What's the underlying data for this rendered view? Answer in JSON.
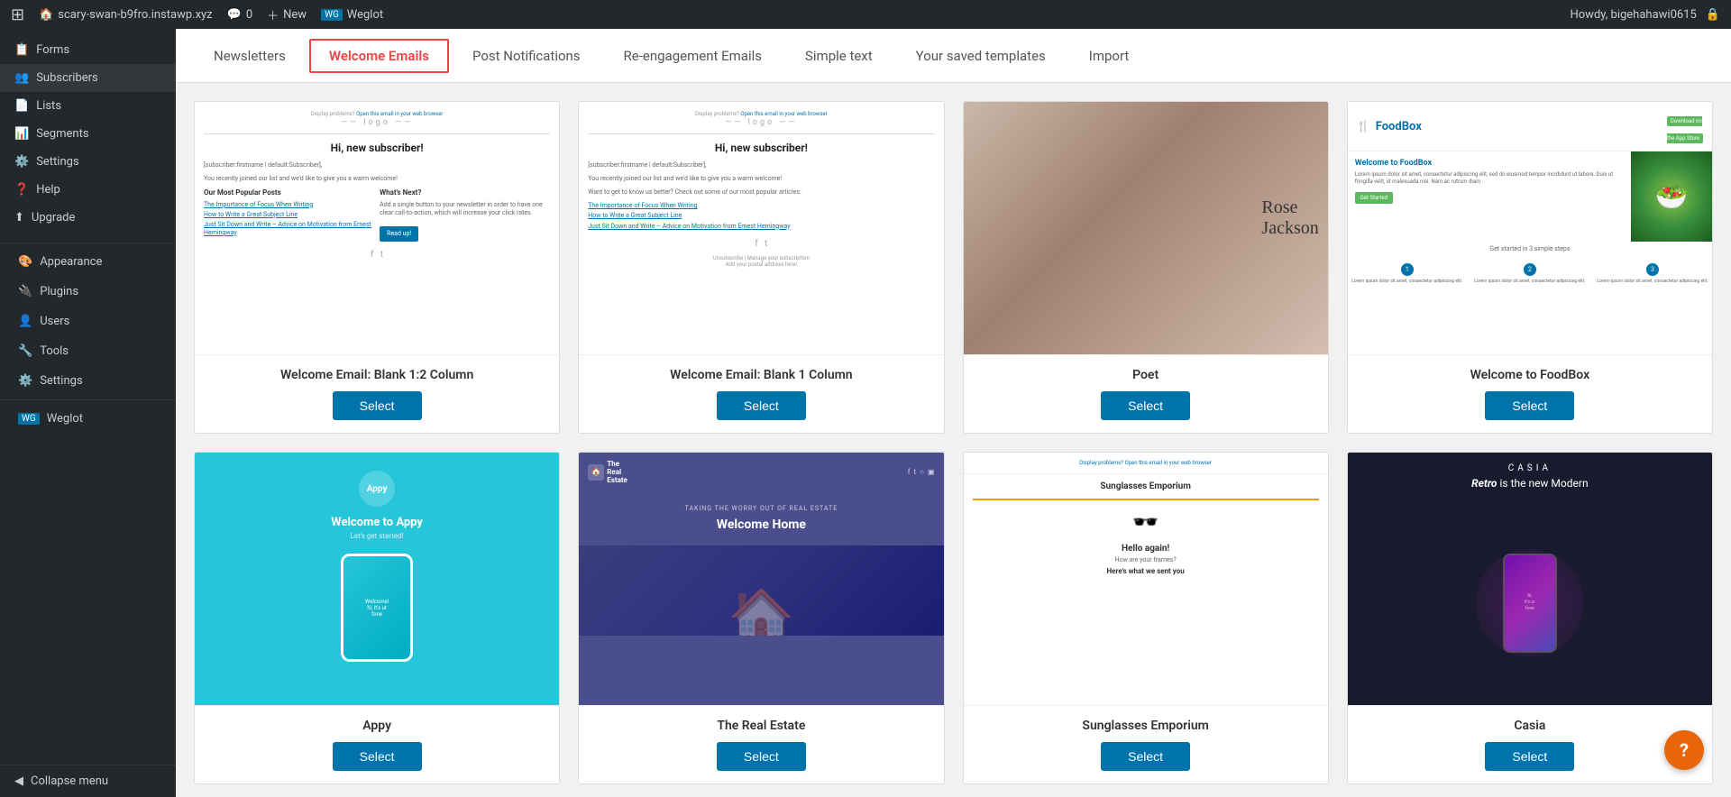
{
  "adminBar": {
    "site": "scary-swan-b9fro.instawp.xyz",
    "comments": "0",
    "new": "New",
    "plugin": "Weglot",
    "user": "Howdy, bigehahawi0615",
    "lockIcon": "🔒"
  },
  "sidebar": {
    "items": [
      {
        "id": "forms",
        "label": "Forms",
        "icon": ""
      },
      {
        "id": "subscribers",
        "label": "Subscribers",
        "icon": ""
      },
      {
        "id": "lists",
        "label": "Lists",
        "icon": ""
      },
      {
        "id": "segments",
        "label": "Segments",
        "icon": ""
      },
      {
        "id": "settings",
        "label": "Settings",
        "icon": ""
      },
      {
        "id": "help",
        "label": "Help",
        "icon": ""
      },
      {
        "id": "upgrade",
        "label": "Upgrade",
        "icon": ""
      }
    ],
    "groups": [
      {
        "id": "appearance",
        "label": "Appearance",
        "icon": "🎨"
      },
      {
        "id": "plugins",
        "label": "Plugins",
        "icon": "🔌"
      },
      {
        "id": "users",
        "label": "Users",
        "icon": "👤"
      },
      {
        "id": "tools",
        "label": "Tools",
        "icon": "🔧"
      },
      {
        "id": "settings",
        "label": "Settings",
        "icon": "⚙️"
      },
      {
        "id": "weglot",
        "label": "Weglot",
        "icon": "WG"
      }
    ],
    "collapse": "Collapse menu"
  },
  "tabs": [
    {
      "id": "newsletters",
      "label": "Newsletters",
      "active": false
    },
    {
      "id": "welcome-emails",
      "label": "Welcome Emails",
      "active": true
    },
    {
      "id": "post-notifications",
      "label": "Post Notifications",
      "active": false
    },
    {
      "id": "re-engagement",
      "label": "Re-engagement Emails",
      "active": false
    },
    {
      "id": "simple-text",
      "label": "Simple text",
      "active": false
    },
    {
      "id": "saved-templates",
      "label": "Your saved templates",
      "active": false
    },
    {
      "id": "import",
      "label": "Import",
      "active": false
    }
  ],
  "templates": [
    {
      "id": "blank-12-column",
      "name": "Welcome Email: Blank 1:2 Column",
      "selectLabel": "Select",
      "type": "blank12"
    },
    {
      "id": "blank-1-column",
      "name": "Welcome Email: Blank 1 Column",
      "selectLabel": "Select",
      "type": "blank1"
    },
    {
      "id": "poet",
      "name": "Poet",
      "selectLabel": "Select",
      "type": "poet"
    },
    {
      "id": "foodbox",
      "name": "Welcome to FoodBox",
      "selectLabel": "Select",
      "type": "foodbox"
    },
    {
      "id": "appy",
      "name": "Appy",
      "selectLabel": "Select",
      "type": "appy"
    },
    {
      "id": "realestate",
      "name": "The Real Estate",
      "selectLabel": "Select",
      "type": "realestate"
    },
    {
      "id": "sunglasses",
      "name": "Sunglasses Emporium",
      "selectLabel": "Select",
      "type": "sunglasses"
    },
    {
      "id": "casia",
      "name": "Casia",
      "selectLabel": "Select",
      "type": "casia"
    }
  ],
  "helpBubble": "?"
}
